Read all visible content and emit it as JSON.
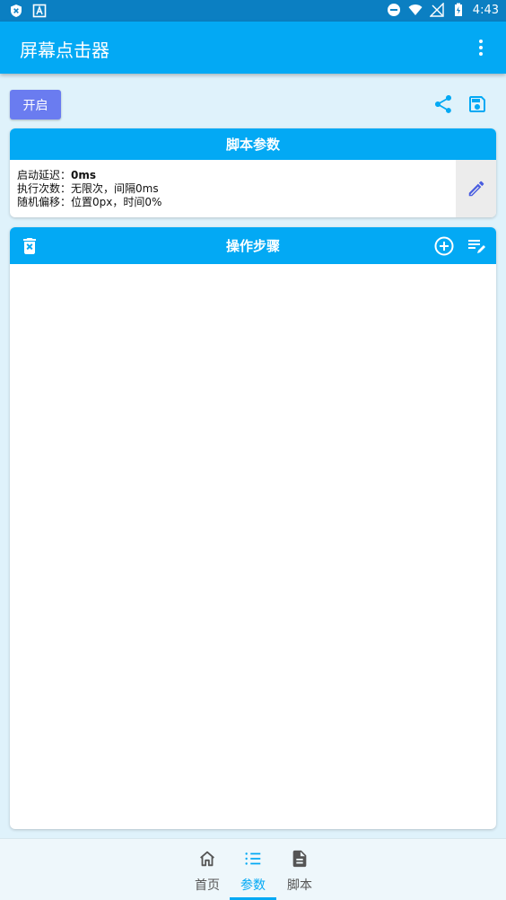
{
  "status_bar": {
    "time": "4:43",
    "left_icons": [
      "shield-x-icon",
      "font-a-icon"
    ],
    "right_icons": [
      "do-not-disturb-icon",
      "wifi-icon",
      "no-signal-icon",
      "battery-charging-icon"
    ]
  },
  "app_bar": {
    "title": "屏幕点击器",
    "menu_icon": "more-vert-icon"
  },
  "toolbar": {
    "start_label": "开启",
    "share_icon": "share-icon",
    "save_icon": "save-icon"
  },
  "script_params": {
    "header": "脚本参数",
    "lines": [
      {
        "label": "启动延迟：",
        "value": "0ms"
      },
      {
        "label": "执行次数：",
        "value": "无限次，间隔0ms"
      },
      {
        "label": "随机偏移：",
        "value": "位置0px，时间0%"
      }
    ],
    "edit_icon": "pencil-icon"
  },
  "steps": {
    "header": "操作步骤",
    "delete_icon": "trash-icon",
    "add_icon": "add-circle-icon",
    "edit_list_icon": "edit-list-icon",
    "items": []
  },
  "bottom_nav": {
    "items": [
      {
        "label": "首页",
        "icon": "home-icon",
        "active": false
      },
      {
        "label": "参数",
        "icon": "list-icon",
        "active": true
      },
      {
        "label": "脚本",
        "icon": "document-icon",
        "active": false
      }
    ]
  },
  "colors": {
    "primary": "#03a9f4",
    "status_bar": "#0b7fc2",
    "start_button": "#6a7cf0",
    "background": "#dff2fb"
  }
}
